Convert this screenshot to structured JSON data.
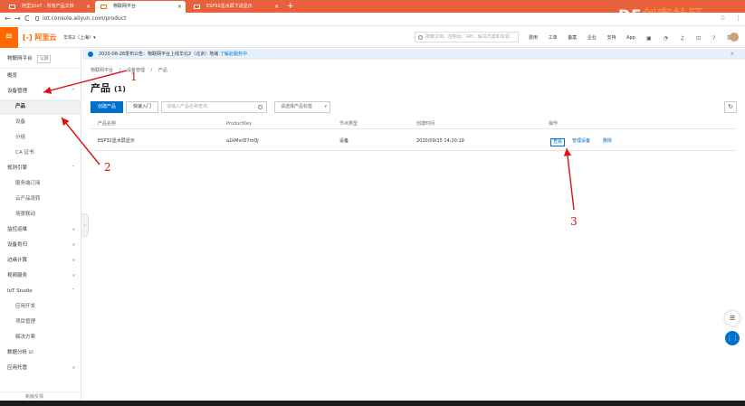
{
  "browser": {
    "tabs": [
      {
        "label": "阿里云IoT - 所有产品文档"
      },
      {
        "label": "物联网平台"
      },
      {
        "label": "ESP32显水屏下进显示"
      }
    ],
    "new_tab": "+",
    "watermark": "DF创客社区",
    "url": "iot.console.aliyun.com/product",
    "nav": {
      "back": "←",
      "forward": "→",
      "reload": "C"
    },
    "right_icons": [
      "☆",
      "⋮"
    ]
  },
  "header": {
    "menu_icon": "≡",
    "logo": "[-] 阿里云",
    "region": "华东2（上海）▾",
    "search_placeholder": "搜索文档、控制台、API、解决方案和资源",
    "nav": [
      "费用",
      "工单",
      "备案",
      "企业",
      "支持",
      "App"
    ],
    "icons": [
      "▣",
      "◔",
      "♫",
      "⊡",
      "?",
      "简体"
    ]
  },
  "sidebar": {
    "title": "物联网平台",
    "tag": "公测",
    "items": [
      {
        "label": "概览",
        "type": "top"
      },
      {
        "label": "设备管理",
        "type": "top",
        "chev": "^"
      },
      {
        "label": "产品",
        "type": "child",
        "active": true
      },
      {
        "label": "设备",
        "type": "child"
      },
      {
        "label": "分组",
        "type": "child"
      },
      {
        "label": "CA 证书",
        "type": "child"
      },
      {
        "label": "规则引擎",
        "type": "top",
        "chev": "^"
      },
      {
        "label": "服务端订阅",
        "type": "child"
      },
      {
        "label": "云产品流转",
        "type": "child"
      },
      {
        "label": "场景联动",
        "type": "child"
      },
      {
        "label": "监控运维",
        "type": "top",
        "chev": "v"
      },
      {
        "label": "设备划归",
        "type": "top",
        "chev": "v"
      },
      {
        "label": "边缘计算",
        "type": "top",
        "chev": "v"
      },
      {
        "label": "视频服务",
        "type": "top",
        "chev": "v"
      },
      {
        "label": "IoT Studio",
        "type": "top",
        "chev": "^"
      },
      {
        "label": "应用开发",
        "type": "child"
      },
      {
        "label": "项目管理",
        "type": "child"
      },
      {
        "label": "解决方案",
        "type": "child"
      },
      {
        "label": "数据分析 ☑",
        "type": "top"
      },
      {
        "label": "应用托管",
        "type": "top",
        "chev": "v"
      }
    ],
    "footer": "新版反馈",
    "collapse": "‹"
  },
  "notice": {
    "text": "2020-08-28发布公告：物联网平台上线华北2（北京）地域 ",
    "link": "了解此服务中",
    "close": "×"
  },
  "main": {
    "breadcrumb": [
      "物联网平台",
      "/",
      "设备管理",
      "/",
      "产品"
    ],
    "title": "产品",
    "count": "(1)",
    "create_button": "创建产品",
    "quick_button": "快速入门",
    "search_placeholder": "请输入产品名称查询",
    "select_label": "请选择产品标签",
    "refresh": "↻",
    "table": {
      "headers": [
        "产品名称",
        "ProductKey",
        "节点类型",
        "创建时间",
        "操作"
      ],
      "rows": [
        {
          "name": "ESP32显水屏显示",
          "key": "a1kMvrD7mQj",
          "node": "设备",
          "created": "2020/09/15 14:20:19",
          "actions": [
            "查看",
            "管理设备",
            "删除"
          ]
        }
      ]
    }
  },
  "float": {
    "chat": "☰",
    "grid": "⋮⋮"
  },
  "annotations": {
    "n1": "1",
    "n2": "2",
    "n3": "3",
    "color": "#dd1111"
  }
}
